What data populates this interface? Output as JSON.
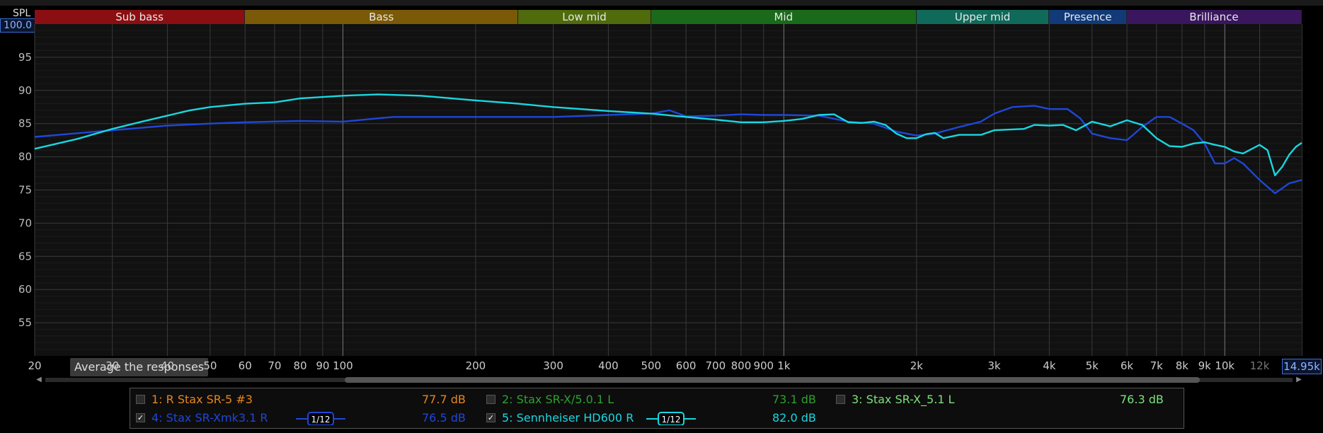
{
  "axis": {
    "y_label": "SPL",
    "y_top": "100.0",
    "x_top": "14.95k"
  },
  "bands": [
    {
      "label": "Sub bass",
      "from": 20,
      "to": 60,
      "color": "#8b0f12"
    },
    {
      "label": "Bass",
      "from": 60,
      "to": 250,
      "color": "#7a5a08"
    },
    {
      "label": "Low mid",
      "from": 250,
      "to": 500,
      "color": "#4f6b0b"
    },
    {
      "label": "Mid",
      "from": 500,
      "to": 2000,
      "color": "#1b6a1b"
    },
    {
      "label": "Upper mid",
      "from": 2000,
      "to": 4000,
      "color": "#106a5a"
    },
    {
      "label": "Presence",
      "from": 4000,
      "to": 6000,
      "color": "#123a78"
    },
    {
      "label": "Brilliance",
      "from": 6000,
      "to": 20000,
      "color": "#3a165e"
    }
  ],
  "average_button": "Average the responses",
  "legend": {
    "items": [
      {
        "index_label": "1: R Stax SR-5 #3",
        "value": "77.7 dB",
        "checked": false,
        "color": "#e8851f"
      },
      {
        "index_label": "2: Stax SR-X/5.0.1 L",
        "value": "73.1 dB",
        "checked": false,
        "color": "#2fa02f"
      },
      {
        "index_label": "3: Stax SR-X_5.1 L",
        "value": "76.3 dB",
        "checked": false,
        "color": "#7ce27c"
      },
      {
        "index_label": "4: Stax SR-Xmk3.1 R",
        "value": "76.5 dB",
        "checked": true,
        "color": "#1f47d8",
        "smoothing": "1/12"
      },
      {
        "index_label": "5: Sennheiser HD600 R",
        "value": "82.0 dB",
        "checked": true,
        "color": "#19d7e0",
        "smoothing": "1/12"
      }
    ]
  },
  "chart_data": {
    "type": "line",
    "xscale": "log",
    "xlim": [
      20,
      14950
    ],
    "ylim": [
      50,
      100
    ],
    "ylabel": "SPL",
    "x_ticks": [
      20,
      30,
      40,
      50,
      60,
      70,
      80,
      90,
      100,
      200,
      300,
      400,
      500,
      600,
      700,
      800,
      900,
      1000,
      2000,
      3000,
      4000,
      5000,
      6000,
      7000,
      8000,
      9000,
      10000,
      12000
    ],
    "x_tick_labels": [
      "20",
      "30",
      "40",
      "50",
      "60",
      "70",
      "80",
      "90",
      "100",
      "200",
      "300",
      "400",
      "500",
      "600",
      "700",
      "800",
      "900",
      "1k",
      "2k",
      "3k",
      "4k",
      "5k",
      "6k",
      "7k",
      "8k",
      "9k",
      "10k",
      "12k"
    ],
    "y_ticks": [
      55,
      60,
      65,
      70,
      75,
      80,
      85,
      90,
      95
    ],
    "y_tick_labels": [
      "55",
      "60",
      "65",
      "70",
      "75",
      "80",
      "85",
      "90",
      "95"
    ],
    "series": [
      {
        "name": "4: Stax SR-Xmk3.1 R",
        "color": "#1f47d8",
        "points": [
          [
            20,
            83.0
          ],
          [
            30,
            84.0
          ],
          [
            40,
            84.7
          ],
          [
            50,
            85.0
          ],
          [
            60,
            85.2
          ],
          [
            80,
            85.4
          ],
          [
            100,
            85.3
          ],
          [
            130,
            86.0
          ],
          [
            200,
            86.0
          ],
          [
            300,
            86.0
          ],
          [
            400,
            86.3
          ],
          [
            500,
            86.5
          ],
          [
            550,
            87.0
          ],
          [
            600,
            86.1
          ],
          [
            700,
            86.2
          ],
          [
            800,
            86.4
          ],
          [
            900,
            86.3
          ],
          [
            1000,
            86.3
          ],
          [
            1200,
            86.2
          ],
          [
            1400,
            85.3
          ],
          [
            1600,
            85.0
          ],
          [
            1800,
            83.8
          ],
          [
            2000,
            83.2
          ],
          [
            2200,
            83.5
          ],
          [
            2500,
            84.5
          ],
          [
            2800,
            85.3
          ],
          [
            3000,
            86.5
          ],
          [
            3300,
            87.5
          ],
          [
            3700,
            87.7
          ],
          [
            4000,
            87.2
          ],
          [
            4400,
            87.2
          ],
          [
            4700,
            85.8
          ],
          [
            5000,
            83.5
          ],
          [
            5500,
            82.8
          ],
          [
            6000,
            82.5
          ],
          [
            6500,
            84.5
          ],
          [
            7000,
            86.0
          ],
          [
            7500,
            86.0
          ],
          [
            8000,
            85.0
          ],
          [
            8500,
            84.0
          ],
          [
            9000,
            82.0
          ],
          [
            9500,
            79.0
          ],
          [
            10000,
            79.0
          ],
          [
            10500,
            79.8
          ],
          [
            11000,
            79.0
          ],
          [
            12000,
            76.5
          ],
          [
            13000,
            74.5
          ],
          [
            14000,
            76.0
          ],
          [
            14950,
            76.5
          ]
        ]
      },
      {
        "name": "5: Sennheiser HD600 R",
        "color": "#19d7e0",
        "points": [
          [
            20,
            81.2
          ],
          [
            25,
            82.7
          ],
          [
            30,
            84.2
          ],
          [
            35,
            85.3
          ],
          [
            40,
            86.2
          ],
          [
            45,
            87.0
          ],
          [
            50,
            87.5
          ],
          [
            60,
            88.0
          ],
          [
            70,
            88.2
          ],
          [
            80,
            88.8
          ],
          [
            100,
            89.2
          ],
          [
            120,
            89.4
          ],
          [
            150,
            89.2
          ],
          [
            200,
            88.5
          ],
          [
            250,
            88.0
          ],
          [
            300,
            87.5
          ],
          [
            400,
            86.9
          ],
          [
            500,
            86.5
          ],
          [
            600,
            86.0
          ],
          [
            700,
            85.6
          ],
          [
            800,
            85.2
          ],
          [
            900,
            85.2
          ],
          [
            1000,
            85.4
          ],
          [
            1100,
            85.7
          ],
          [
            1200,
            86.3
          ],
          [
            1300,
            86.4
          ],
          [
            1400,
            85.2
          ],
          [
            1500,
            85.1
          ],
          [
            1600,
            85.3
          ],
          [
            1700,
            84.8
          ],
          [
            1800,
            83.5
          ],
          [
            1900,
            82.8
          ],
          [
            2000,
            82.8
          ],
          [
            2100,
            83.4
          ],
          [
            2200,
            83.6
          ],
          [
            2300,
            82.8
          ],
          [
            2500,
            83.3
          ],
          [
            2800,
            83.3
          ],
          [
            3000,
            84.0
          ],
          [
            3500,
            84.2
          ],
          [
            3700,
            84.8
          ],
          [
            4000,
            84.7
          ],
          [
            4300,
            84.8
          ],
          [
            4600,
            84.0
          ],
          [
            5000,
            85.3
          ],
          [
            5500,
            84.6
          ],
          [
            6000,
            85.5
          ],
          [
            6500,
            84.8
          ],
          [
            7000,
            82.8
          ],
          [
            7500,
            81.6
          ],
          [
            8000,
            81.5
          ],
          [
            8500,
            82.0
          ],
          [
            9000,
            82.2
          ],
          [
            9500,
            81.8
          ],
          [
            10000,
            81.5
          ],
          [
            10500,
            80.8
          ],
          [
            11000,
            80.5
          ],
          [
            12000,
            81.8
          ],
          [
            12500,
            81.0
          ],
          [
            13000,
            77.2
          ],
          [
            13500,
            78.5
          ],
          [
            14000,
            80.3
          ],
          [
            14500,
            81.5
          ],
          [
            14950,
            82.1
          ]
        ]
      }
    ]
  }
}
